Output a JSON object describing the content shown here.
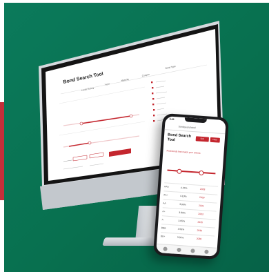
{
  "desktop": {
    "title": "Bond Search Tool",
    "columns": [
      "Credit Rating",
      "Yield",
      "Maturity",
      "Coupon",
      "Bond Type"
    ],
    "primary_button": "Search",
    "fields": [
      "Min",
      "Max"
    ]
  },
  "phone": {
    "status_time": "9:41",
    "header": "bondsearchtool",
    "title": "Bond Search Tool",
    "buttons": [
      "Sort",
      "Filter"
    ],
    "subtitle": "Find bonds that match your criteria",
    "rows": [
      {
        "a": "AAA",
        "b": "4.25%",
        "c": "2028"
      },
      {
        "a": "AA+",
        "b": "4.10%",
        "c": "2030"
      },
      {
        "a": "AA",
        "b": "3.95%",
        "c": "2031"
      },
      {
        "a": "A+",
        "b": "3.80%",
        "c": "2033"
      },
      {
        "a": "A",
        "b": "3.65%",
        "c": "2035"
      },
      {
        "a": "BBB",
        "b": "3.50%",
        "c": "2036"
      },
      {
        "a": "BB+",
        "b": "3.35%",
        "c": "2038"
      }
    ]
  },
  "colors": {
    "background": "#0a7255",
    "accent": "#c4262e",
    "left_strip": "#c42f3a"
  }
}
